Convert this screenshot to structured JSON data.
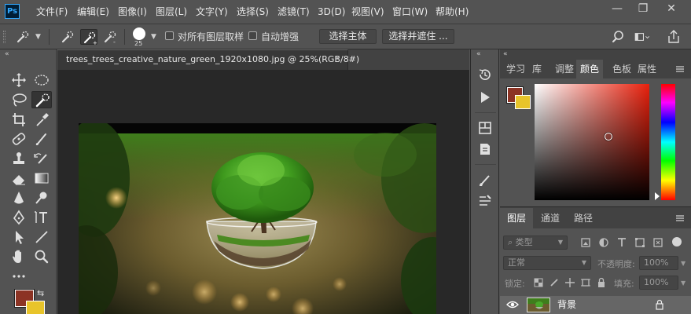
{
  "app": {
    "logo": "Ps"
  },
  "menu": [
    "文件(F)",
    "编辑(E)",
    "图像(I)",
    "图层(L)",
    "文字(Y)",
    "选择(S)",
    "滤镜(T)",
    "3D(D)",
    "视图(V)",
    "窗口(W)",
    "帮助(H)"
  ],
  "window_controls": {
    "minimize": "—",
    "restore": "❐",
    "close": "✕"
  },
  "options": {
    "brush_size": "25",
    "sample_all_layers": "对所有图层取样",
    "auto_enhance": "自动增强",
    "select_subject": "选择主体",
    "select_and_mask": "选择并遮住 ..."
  },
  "document": {
    "tab_title": "trees_trees_creative_nature_green_1920x1080.jpg @ 25%(RGB/8#)",
    "close": "×"
  },
  "panels": {
    "collapse": "«",
    "top_tabs": [
      "学习",
      "库",
      "调整",
      "颜色",
      "色板",
      "属性"
    ],
    "active_top_tab": "颜色",
    "bottom_tabs": [
      "图层",
      "通道",
      "路径"
    ],
    "active_bottom_tab": "图层",
    "filter_kind": "类型",
    "blend_mode": "正常",
    "opacity_label": "不透明度:",
    "opacity_value": "100%",
    "lock_label": "锁定:",
    "fill_label": "填充:",
    "fill_value": "100%",
    "layer_name": "背景"
  },
  "colors": {
    "foreground": "#8c3324",
    "background": "#e8c42a",
    "ui_dark": "#535353",
    "canvas_bg": "#282828",
    "ps_blue": "#31a8ff"
  },
  "icons": [
    "quick-selection-icon",
    "move-icon",
    "marquee-icon",
    "lasso-icon",
    "crop-icon",
    "eyedropper-icon",
    "healing-brush-icon",
    "brush-icon",
    "stamp-icon",
    "history-brush-icon",
    "eraser-icon",
    "gradient-icon",
    "blur-icon",
    "dodge-icon",
    "pen-icon",
    "type-icon",
    "path-selection-icon",
    "line-icon",
    "hand-icon",
    "zoom-icon",
    "search-icon",
    "workspace-icon",
    "share-icon",
    "eye-icon",
    "lock-icon"
  ]
}
